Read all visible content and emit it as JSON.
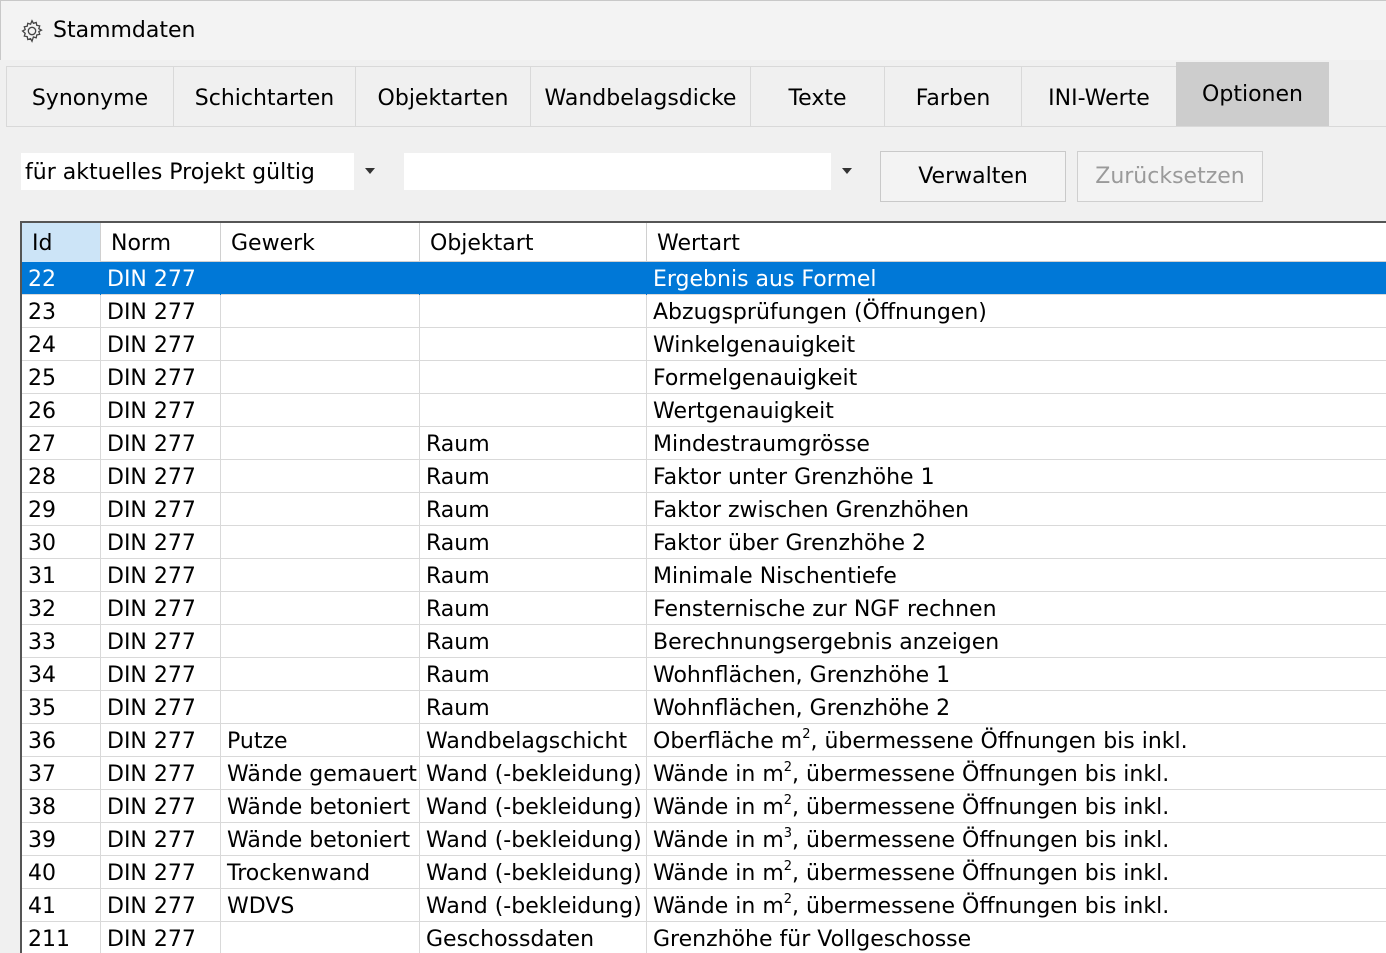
{
  "window": {
    "title": "Stammdaten",
    "icon": "gear-icon"
  },
  "tabs": [
    {
      "label": "Synonyme",
      "active": false
    },
    {
      "label": "Schichtarten",
      "active": false
    },
    {
      "label": "Objektarten",
      "active": false
    },
    {
      "label": "Wandbelagsdicke",
      "active": false
    },
    {
      "label": "Texte",
      "active": false
    },
    {
      "label": "Farben",
      "active": false
    },
    {
      "label": "INI-Werte",
      "active": false
    },
    {
      "label": "Optionen",
      "active": true
    }
  ],
  "toolbar": {
    "scope_combo_value": "für aktuelles Projekt gültig",
    "second_combo_value": "",
    "manage_label": "Verwalten",
    "reset_label": "Zurücksetzen",
    "reset_enabled": false
  },
  "table": {
    "columns": [
      "Id",
      "Norm",
      "Gewerk",
      "Objektart",
      "Wertart"
    ],
    "selected_id": "22",
    "rows": [
      {
        "id": "22",
        "norm": "DIN 277",
        "gewerk": "",
        "objektart": "",
        "wertart": "Ergebnis aus Formel"
      },
      {
        "id": "23",
        "norm": "DIN 277",
        "gewerk": "",
        "objektart": "",
        "wertart": "Abzugsprüfungen (Öffnungen)"
      },
      {
        "id": "24",
        "norm": "DIN 277",
        "gewerk": "",
        "objektart": "",
        "wertart": "Winkelgenauigkeit"
      },
      {
        "id": "25",
        "norm": "DIN 277",
        "gewerk": "",
        "objektart": "",
        "wertart": "Formelgenauigkeit"
      },
      {
        "id": "26",
        "norm": "DIN 277",
        "gewerk": "",
        "objektart": "",
        "wertart": "Wertgenauigkeit"
      },
      {
        "id": "27",
        "norm": "DIN 277",
        "gewerk": "",
        "objektart": "Raum",
        "wertart": "Mindestraumgrösse"
      },
      {
        "id": "28",
        "norm": "DIN 277",
        "gewerk": "",
        "objektart": "Raum",
        "wertart": "Faktor unter Grenzhöhe 1"
      },
      {
        "id": "29",
        "norm": "DIN 277",
        "gewerk": "",
        "objektart": "Raum",
        "wertart": "Faktor zwischen Grenzhöhen"
      },
      {
        "id": "30",
        "norm": "DIN 277",
        "gewerk": "",
        "objektart": "Raum",
        "wertart": "Faktor über Grenzhöhe 2"
      },
      {
        "id": "31",
        "norm": "DIN 277",
        "gewerk": "",
        "objektart": "Raum",
        "wertart": "Minimale Nischentiefe"
      },
      {
        "id": "32",
        "norm": "DIN 277",
        "gewerk": "",
        "objektart": "Raum",
        "wertart": "Fensternische zur NGF rechnen"
      },
      {
        "id": "33",
        "norm": "DIN 277",
        "gewerk": "",
        "objektart": "Raum",
        "wertart": "Berechnungsergebnis anzeigen"
      },
      {
        "id": "34",
        "norm": "DIN 277",
        "gewerk": "",
        "objektart": "Raum",
        "wertart": "Wohnflächen, Grenzhöhe 1"
      },
      {
        "id": "35",
        "norm": "DIN 277",
        "gewerk": "",
        "objektart": "Raum",
        "wertart": "Wohnflächen, Grenzhöhe 2"
      },
      {
        "id": "36",
        "norm": "DIN 277",
        "gewerk": "Putze",
        "objektart": "Wandbelagschicht",
        "wertart_pre": "Oberfläche m",
        "wertart_sup": "2",
        "wertart_post": ", übermessene Öffnungen bis inkl."
      },
      {
        "id": "37",
        "norm": "DIN 277",
        "gewerk": "Wände gemauert",
        "objektart": "Wand (-bekleidung)",
        "wertart_pre": "Wände in m",
        "wertart_sup": "2",
        "wertart_post": ", übermessene Öffnungen bis inkl."
      },
      {
        "id": "38",
        "norm": "DIN 277",
        "gewerk": "Wände betoniert",
        "objektart": "Wand (-bekleidung)",
        "wertart_pre": "Wände in m",
        "wertart_sup": "2",
        "wertart_post": ", übermessene Öffnungen bis inkl."
      },
      {
        "id": "39",
        "norm": "DIN 277",
        "gewerk": "Wände betoniert",
        "objektart": "Wand (-bekleidung)",
        "wertart_pre": "Wände in m",
        "wertart_sup": "3",
        "wertart_post": ", übermessene Öffnungen bis inkl."
      },
      {
        "id": "40",
        "norm": "DIN 277",
        "gewerk": "Trockenwand",
        "objektart": "Wand (-bekleidung)",
        "wertart_pre": "Wände in m",
        "wertart_sup": "2",
        "wertart_post": ", übermessene Öffnungen bis inkl."
      },
      {
        "id": "41",
        "norm": "DIN 277",
        "gewerk": "WDVS",
        "objektart": "Wand (-bekleidung)",
        "wertart_pre": "Wände in m",
        "wertart_sup": "2",
        "wertart_post": ", übermessene Öffnungen bis inkl."
      },
      {
        "id": "211",
        "norm": "DIN 277",
        "gewerk": "",
        "objektart": "Geschossdaten",
        "wertart": "Grenzhöhe für Vollgeschosse"
      }
    ]
  }
}
